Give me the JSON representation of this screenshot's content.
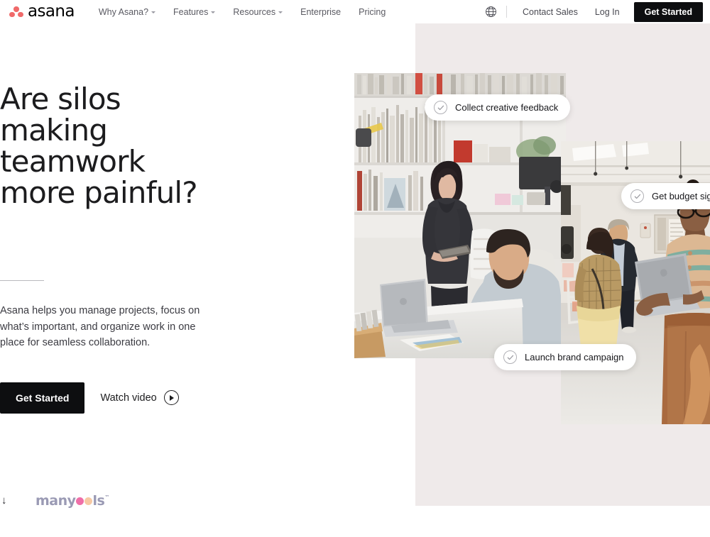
{
  "brand": {
    "logo_text": "asana",
    "logo_dot_color": "#f06a6a"
  },
  "nav": {
    "items": [
      {
        "label": "Why Asana?",
        "has_caret": true
      },
      {
        "label": "Features",
        "has_caret": true
      },
      {
        "label": "Resources",
        "has_caret": true
      },
      {
        "label": "Enterprise",
        "has_caret": false
      },
      {
        "label": "Pricing",
        "has_caret": false
      }
    ],
    "globe_icon": "globe-icon",
    "contact_sales": "Contact Sales",
    "log_in": "Log In",
    "get_started": "Get Started"
  },
  "hero": {
    "title": "Are silos making teamwork more painful?",
    "subtitle": "Asana helps you manage projects, focus on what’s important, and organize work in one place for seamless collaboration.",
    "primary_cta": "Get Started",
    "secondary_cta": "Watch video",
    "play_icon": "play-icon"
  },
  "task_pills": [
    {
      "label": "Collect creative feedback",
      "icon": "check-circle-icon"
    },
    {
      "label": "Get budget sign-off",
      "icon": "check-circle-icon"
    },
    {
      "label": "Launch brand campaign",
      "icon": "check-circle-icon"
    }
  ],
  "watermark": {
    "arrow": "↓",
    "text_start": "many",
    "text_end": "ls",
    "trademark": "™",
    "dot1_color": "#ef6fa8",
    "dot2_color": "#f7c9a4"
  },
  "colors": {
    "backdrop": "#efeaea",
    "dark_button": "#0d0e10",
    "accent": "#f06a6a"
  }
}
